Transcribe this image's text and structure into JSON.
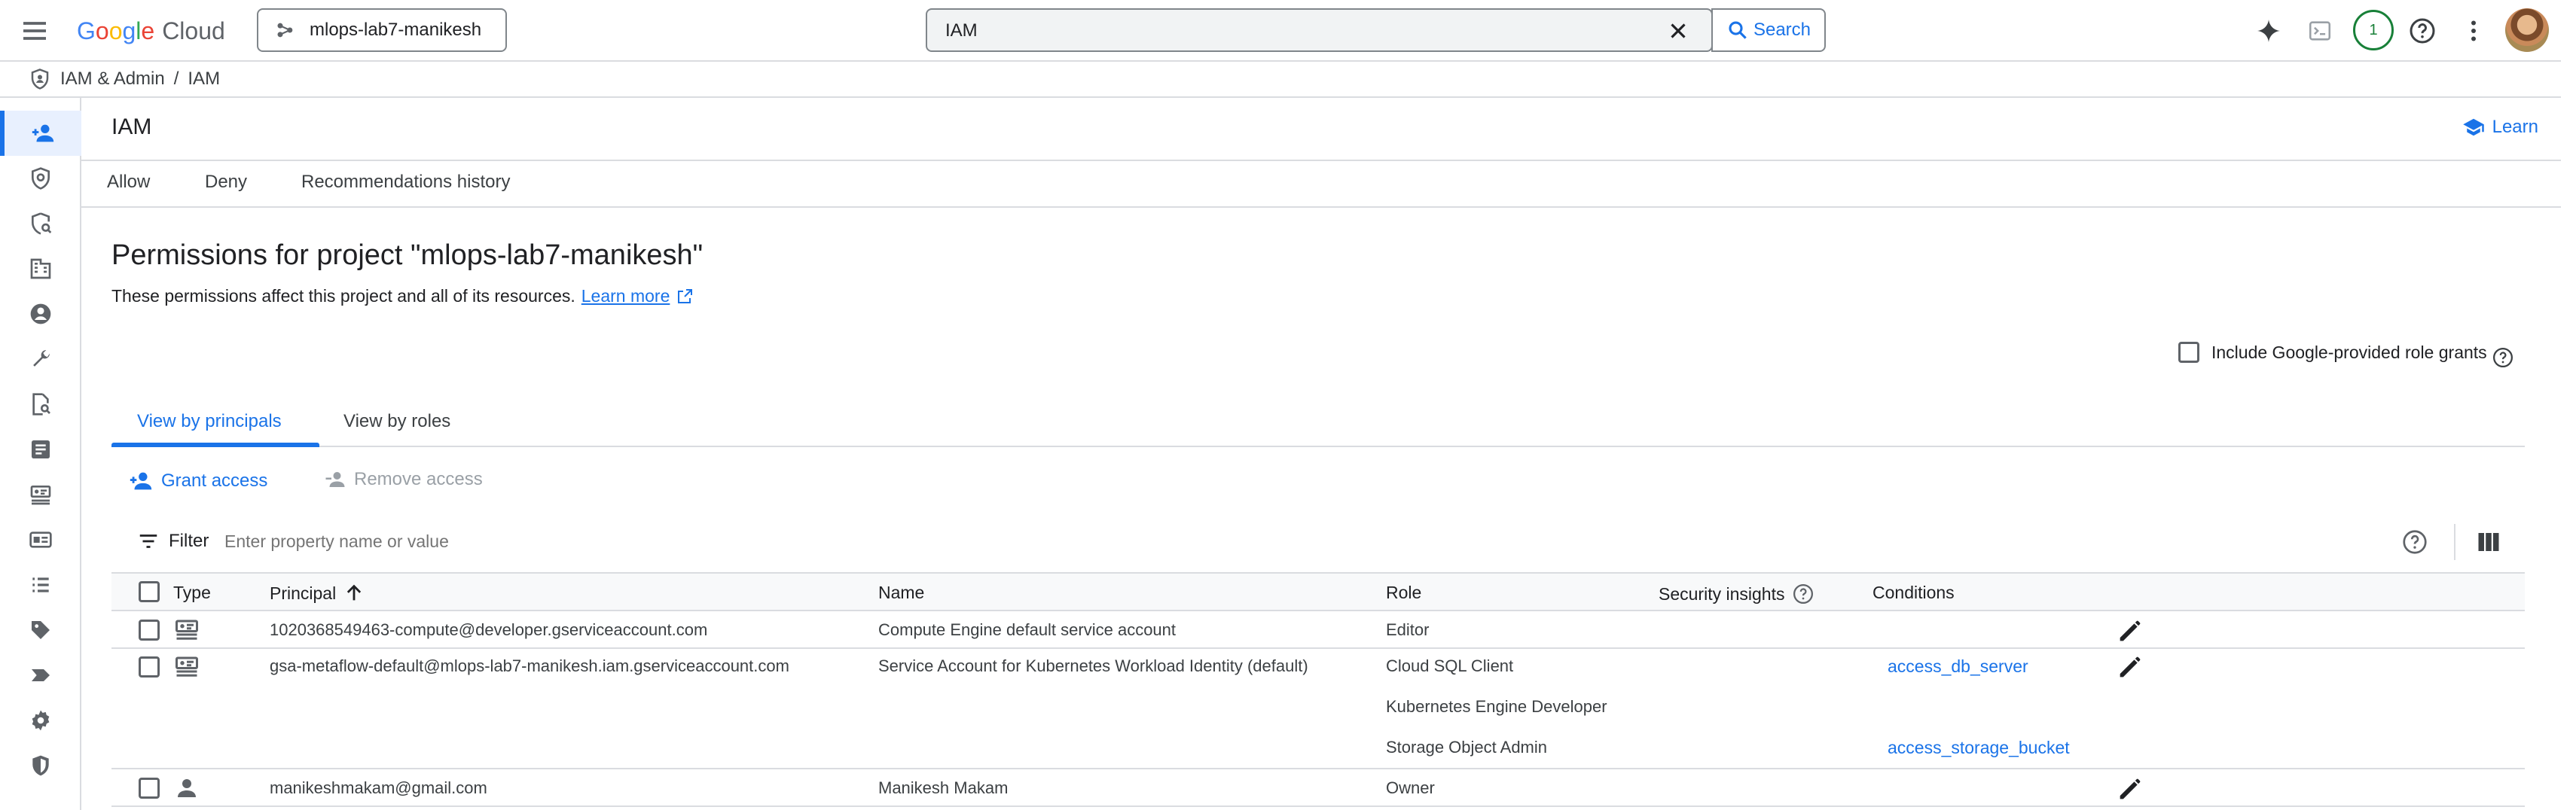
{
  "topbar": {
    "logo_google": [
      "G",
      "o",
      "o",
      "g",
      "l",
      "e"
    ],
    "logo_cloud": "Cloud",
    "project_name": "mlops-lab7-manikesh",
    "search_value": "IAM",
    "search_button": "Search",
    "notifications_count": "1"
  },
  "breadcrumb": {
    "section": "IAM & Admin",
    "separator": "/",
    "current": "IAM"
  },
  "page": {
    "title": "IAM",
    "learn": "Learn",
    "tabs": [
      "Allow",
      "Deny",
      "Recommendations history"
    ]
  },
  "permissions": {
    "title": "Permissions for project \"mlops-lab7-manikesh\"",
    "description": "These permissions affect this project and all of its resources.",
    "learn_more": "Learn more",
    "include_grants": "Include Google-provided role grants",
    "view_tabs": [
      "View by principals",
      "View by roles"
    ],
    "grant_access": "Grant access",
    "remove_access": "Remove access",
    "filter_label": "Filter",
    "filter_placeholder": "Enter property name or value"
  },
  "table": {
    "headers": [
      "Type",
      "Principal",
      "Name",
      "Role",
      "Security insights",
      "Conditions"
    ],
    "rows": [
      {
        "type_icon": "service-account-icon",
        "principal": "1020368549463-compute@developer.gserviceaccount.com",
        "name": "Compute Engine default service account",
        "roles": [
          "Editor"
        ],
        "conditions": [
          ""
        ]
      },
      {
        "type_icon": "service-account-icon",
        "principal": "gsa-metaflow-default@mlops-lab7-manikesh.iam.gserviceaccount.com",
        "name": "Service Account for Kubernetes Workload Identity (default)",
        "roles": [
          "Cloud SQL Client",
          "Kubernetes Engine Developer",
          "Storage Object Admin"
        ],
        "conditions": [
          "access_db_server",
          "",
          "access_storage_bucket"
        ]
      },
      {
        "type_icon": "person-icon",
        "principal": "manikeshmakam@gmail.com",
        "name": "Manikesh Makam",
        "roles": [
          "Owner"
        ],
        "conditions": [
          ""
        ]
      }
    ]
  },
  "colors": {
    "accent": "#1a73e8",
    "border": "#dadce0",
    "text": "#202124",
    "muted": "#5f6368",
    "notif": "#188038"
  }
}
